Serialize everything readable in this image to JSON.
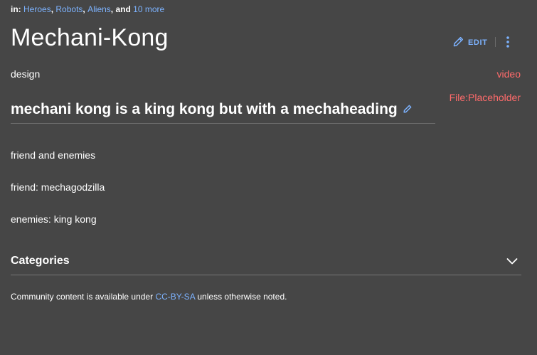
{
  "categories_top": {
    "prefix": "in:",
    "items": [
      "Heroes",
      "Robots",
      "Aliens"
    ],
    "sep1": ",",
    "sep2": ",",
    "sep3": ", and",
    "more": "10 more"
  },
  "page": {
    "title": "Mechani-Kong"
  },
  "toolbar": {
    "edit_label": "EDIT",
    "edit_icon": "pencil-icon",
    "more_icon": "vertical-dots-icon"
  },
  "content": {
    "design": "design",
    "video_link": "video",
    "file_link": "File:Placeholder",
    "heading": "mechani kong is a king kong but with a mechaheading",
    "paragraphs": [
      "friend and enemies",
      "friend: mechagodzilla",
      "enemies: king kong"
    ]
  },
  "categories_section": {
    "label": "Categories",
    "toggle_icon": "chevron-down-icon"
  },
  "footer": {
    "text_before": "Community content is available under",
    "license": "CC-BY-SA",
    "text_after": "unless otherwise noted."
  },
  "colors": {
    "background": "#464646",
    "link": "#7db3ff",
    "redlink": "#ff6b6b"
  }
}
